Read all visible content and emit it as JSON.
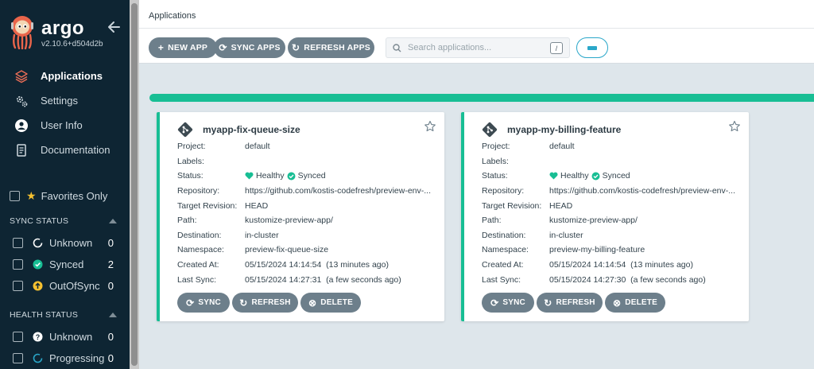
{
  "sidebar": {
    "brand": "argo",
    "version": "v2.10.6+d504d2b",
    "nav": [
      {
        "label": "Applications",
        "icon": "layers-icon",
        "active": true
      },
      {
        "label": "Settings",
        "icon": "gears-icon",
        "active": false
      },
      {
        "label": "User Info",
        "icon": "user-icon",
        "active": false
      },
      {
        "label": "Documentation",
        "icon": "book-icon",
        "active": false
      }
    ],
    "favorites_label": "Favorites Only",
    "sync_status": {
      "title": "SYNC STATUS",
      "items": [
        {
          "label": "Unknown",
          "count": "0"
        },
        {
          "label": "Synced",
          "count": "2"
        },
        {
          "label": "OutOfSync",
          "count": "0"
        }
      ]
    },
    "health_status": {
      "title": "HEALTH STATUS",
      "items": [
        {
          "label": "Unknown",
          "count": "0"
        },
        {
          "label": "Progressing",
          "count": "0"
        }
      ]
    }
  },
  "header": {
    "title": "Applications"
  },
  "toolbar": {
    "new_app": "NEW APP",
    "sync_apps": "SYNC APPS",
    "refresh_apps": "REFRESH APPS",
    "search_placeholder": "Search applications...",
    "search_shortcut": "/"
  },
  "field_labels": {
    "project": "Project:",
    "labels": "Labels:",
    "status": "Status:",
    "repository": "Repository:",
    "target_revision": "Target Revision:",
    "path": "Path:",
    "destination": "Destination:",
    "namespace": "Namespace:",
    "created_at": "Created At:",
    "last_sync": "Last Sync:"
  },
  "card_buttons": {
    "sync": "SYNC",
    "refresh": "REFRESH",
    "delete": "DELETE"
  },
  "apps": [
    {
      "name": "myapp-fix-queue-size",
      "project": "default",
      "labels": "",
      "health": "Healthy",
      "sync": "Synced",
      "repository": "https://github.com/kostis-codefresh/preview-env-...",
      "target_revision": "HEAD",
      "path": "kustomize-preview-app/",
      "destination": "in-cluster",
      "namespace": "preview-fix-queue-size",
      "created_at": "05/15/2024 14:14:54  (13 minutes ago)",
      "last_sync": "05/15/2024 14:27:31  (a few seconds ago)"
    },
    {
      "name": "myapp-my-billing-feature",
      "project": "default",
      "labels": "",
      "health": "Healthy",
      "sync": "Synced",
      "repository": "https://github.com/kostis-codefresh/preview-env-...",
      "target_revision": "HEAD",
      "path": "kustomize-preview-app/",
      "destination": "in-cluster",
      "namespace": "preview-my-billing-feature",
      "created_at": "05/15/2024 14:14:54  (13 minutes ago)",
      "last_sync": "05/15/2024 14:27:30  (a few seconds ago)"
    }
  ],
  "colors": {
    "sidebar_bg": "#0e2533",
    "healthy": "#18be94",
    "button": "#6d7f8b",
    "accent": "#2aa7c9"
  }
}
